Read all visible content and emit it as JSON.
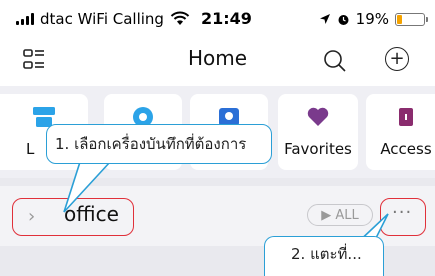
{
  "status_bar": {
    "carrier": "dtac WiFi Calling",
    "time": "21:49",
    "battery": "19%",
    "battery_level": 0.19
  },
  "header": {
    "title": "Home",
    "menu_icon": "list-icon",
    "search_icon": "search-icon",
    "add_icon": "plus-circle-icon",
    "add_symbol": "+"
  },
  "categories": [
    {
      "label": "L",
      "icon": "device-icon",
      "color": "#2ba3e8"
    },
    {
      "label": "",
      "icon": "device-icon",
      "color": "#2ba3e8"
    },
    {
      "label": "",
      "icon": "camera-icon",
      "color": "#2b6fd6"
    },
    {
      "label": "Favorites",
      "icon": "heart-icon",
      "color": "#7a3a8c"
    },
    {
      "label": "Access",
      "icon": "access-icon",
      "color": "#8a2c6e"
    }
  ],
  "room": {
    "chevron": "›",
    "name": "office",
    "all_label": "▶ ALL",
    "more_label": "···"
  },
  "annotations": {
    "step1": "1. เลือกเครื่องบันทึกที่ต้องการ",
    "step2": "2. แตะที่..."
  },
  "colors": {
    "highlight_red": "#e0303a",
    "callout_blue": "#2b9fd6",
    "battery_yellow": "#f5a300"
  }
}
